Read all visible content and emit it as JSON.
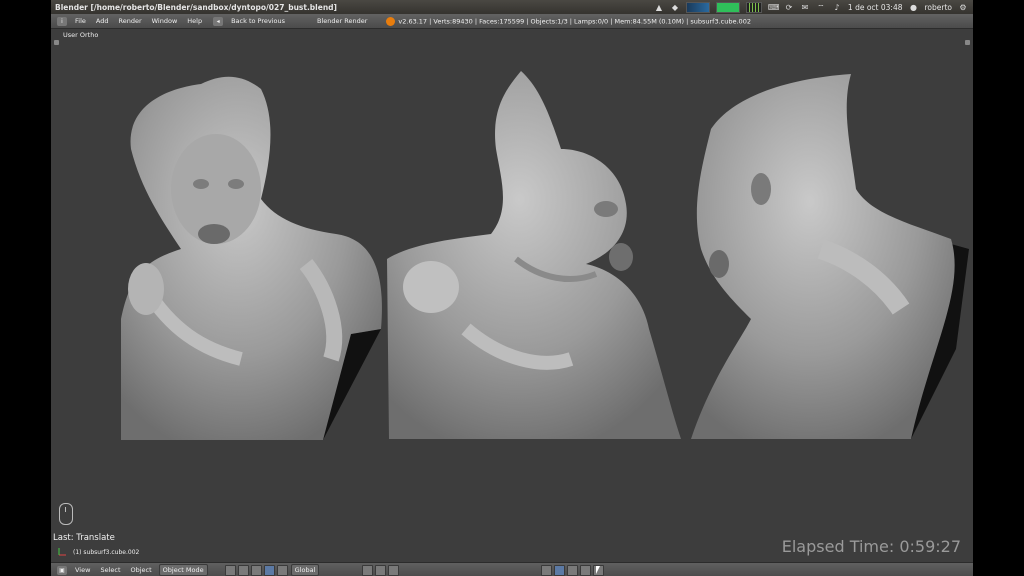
{
  "os_panel": {
    "window_title": "Blender [/home/roberto/Blender/sandbox/dyntopo/027_bust.blend]",
    "clock": "1 de oct 03:48",
    "user": "roberto"
  },
  "info_header": {
    "menus": [
      "File",
      "Add",
      "Render",
      "Window",
      "Help"
    ],
    "back_button": "Back to Previous",
    "render_engine": "Blender Render",
    "stats": "v2.63.17 | Verts:89430 | Faces:175599 | Objects:1/3 | Lamps:0/0 | Mem:84.55M (0.10M) | subsurf3.cube.002"
  },
  "viewport": {
    "view_label": "User Ortho",
    "last_operator": "Last: Translate",
    "active_object": "(1) subsurf3.cube.002",
    "elapsed_time": "Elapsed Time: 0:59:27"
  },
  "view_header": {
    "menus": [
      "View",
      "Select",
      "Object"
    ],
    "mode": "Object Mode",
    "orientation": "Global"
  },
  "colors": {
    "viewport_bg": "#3d3d3d",
    "header_bg": "#555555",
    "sculpt_grey": "#9c9c9c"
  }
}
